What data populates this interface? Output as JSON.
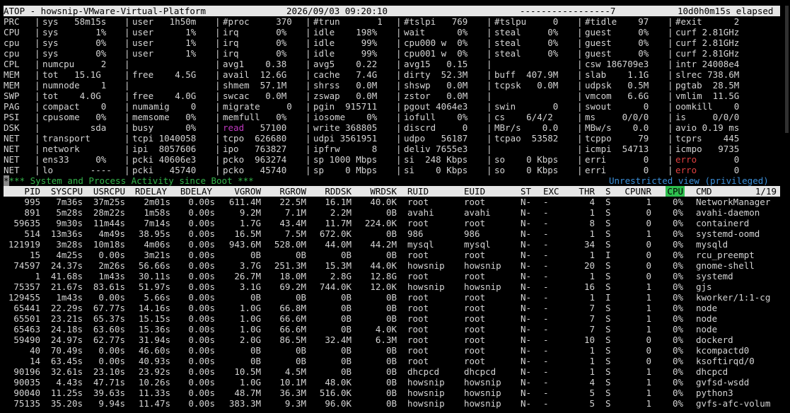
{
  "title": {
    "left": "ATOP - howsnip-VMware-Virtual-Platform",
    "datetime": "2026/09/03 09:20:10",
    "dashes": "-----------------7",
    "elapsed": "10d0h0m15s elapsed"
  },
  "sysstat": [
    {
      "label": "PRC",
      "c": [
        "sys   58m15s",
        "user   1h50m",
        "#proc     370",
        "#trun       1",
        "#tslpi   769",
        "#tslpu     0",
        "#tidle    97",
        "#exit      2"
      ]
    },
    {
      "label": "CPU",
      "c": [
        "sys       1%",
        "user      1%",
        "irq       0%",
        "idle    198%",
        "wait      0%",
        "steal     0%",
        "guest     0%",
        "curf 2.81GHz"
      ]
    },
    {
      "label": "cpu",
      "c": [
        "sys       0%",
        "user      1%",
        "irq       0%",
        "idle     99%",
        "cpu000 w  0%",
        "steal     0%",
        "guest     0%",
        "curf 2.81GHz"
      ]
    },
    {
      "label": "cpu",
      "c": [
        "sys       0%",
        "user      1%",
        "irq       0%",
        "idle     99%",
        "cpu001 w  0%",
        "steal     0%",
        "guest     0%",
        "curf 2.81GHz"
      ]
    },
    {
      "label": "CPL",
      "c": [
        "numcpu     2",
        "",
        "avg1    0.38",
        "avg5    0.22",
        "avg15   0.15",
        "",
        "csw 186709e3",
        "intr 24008e4"
      ]
    },
    {
      "label": "MEM",
      "c": [
        "tot   15.1G",
        "free    4.5G",
        "avail  12.6G",
        "cache   7.4G",
        "dirty  52.3M",
        "buff  407.9M",
        "slab    1.1G",
        "slrec 738.6M"
      ]
    },
    {
      "label": "MEM",
      "c": [
        "numnode    1",
        "",
        "shmem  57.1M",
        "shrss   0.0M",
        "shswp   0.0M",
        "tcpsk   0.0M",
        "udpsk   0.5M",
        "pgtab  28.5M"
      ]
    },
    {
      "label": "SWP",
      "c": [
        "tot    4.0G",
        "free    4.0G",
        "swcac   0.0M",
        "zswap   0.0M",
        "zstor   0.0M",
        "",
        "vmcom   6.6G",
        "vmlim  11.5G"
      ]
    },
    {
      "label": "PAG",
      "c": [
        "compact    0",
        "numamig    0",
        "migrate     0",
        "pgin  915711",
        "pgout 4064e3",
        "swin       0",
        "swout      0",
        "oomkill    0"
      ]
    },
    {
      "label": "PSI",
      "c": [
        "cpusome   0%",
        "memsome   0%",
        "memfull   0%",
        "iosome    0%",
        "iofull    0%",
        "cs    6/4/2",
        "ms     0/0/0",
        "is     0/0/0"
      ]
    },
    {
      "label": "DSK",
      "c": [
        "         sda",
        "busy      0%",
        "read   57100",
        "write 368805",
        "discrd     0",
        "MBr/s    0.0",
        "MBw/s    0.0",
        "avio 0.19 ms"
      ]
    },
    {
      "label": "NET",
      "c": [
        "transport",
        "tcpi 1040058",
        "tcpo  626680",
        "udpi 3561951",
        "udpo   56187",
        "tcpao  53582",
        "tcppo     79",
        "tcprs    445"
      ]
    },
    {
      "label": "NET",
      "c": [
        "network",
        "ipi  8057606",
        "ipo   763827",
        "ipfrw      8",
        "deliv 7655e3",
        "",
        "icmpi  54713",
        "icmpo   9735"
      ]
    },
    {
      "label": "NET",
      "c": [
        "ens33     0%",
        "pcki 40606e3",
        "pcko  963274",
        "sp 1000 Mbps",
        "si  248 Kbps",
        "so    0 Kbps",
        "erri       0",
        "erro       0"
      ]
    },
    {
      "label": "NET",
      "c": [
        "lo       ----",
        "pcki   45740",
        "pcko   45740",
        "sp    0 Mbps",
        "si    0 Kbps",
        "so    0 Kbps",
        "erri       0",
        "erro       0"
      ]
    }
  ],
  "status": {
    "left": "*** System and Process Activity since Boot ***",
    "right": "Unrestricted view (privileged)"
  },
  "columns": [
    "PID",
    "SYSCPU",
    "USRCPU",
    "RDELAY",
    "BDELAY",
    "VGROW",
    "RGROW",
    "RDDSK",
    "WRDSK",
    "RUID",
    "EUID",
    "ST",
    "EXC",
    "THR",
    "S",
    "CPUNR",
    "CPU",
    "CMD",
    "1/19"
  ],
  "processes": [
    [
      "995",
      "7m36s",
      "37m25s",
      "2m01s",
      "0.00s",
      "611.4M",
      "22.5M",
      "16.1M",
      "40.0K",
      "root",
      "root",
      "N-",
      "-",
      "4",
      "S",
      "1",
      "0%",
      "NetworkManager"
    ],
    [
      "891",
      "5m28s",
      "28m22s",
      "1m58s",
      "0.00s",
      "9.2M",
      "7.1M",
      "2.2M",
      "0B",
      "avahi",
      "avahi",
      "N-",
      "-",
      "1",
      "S",
      "0",
      "0%",
      "avahi-daemon"
    ],
    [
      "59635",
      "9m30s",
      "11m44s",
      "7m14s",
      "0.00s",
      "1.7G",
      "43.4M",
      "11.7M",
      "224.0K",
      "root",
      "root",
      "N-",
      "-",
      "8",
      "S",
      "0",
      "0%",
      "containerd"
    ],
    [
      "514",
      "13m36s",
      "4m49s",
      "38.95s",
      "0.00s",
      "16.5M",
      "7.5M",
      "672.0K",
      "0B",
      "986",
      "986",
      "N-",
      "-",
      "1",
      "S",
      "1",
      "0%",
      "systemd-oomd"
    ],
    [
      "121919",
      "3m28s",
      "10m18s",
      "4m06s",
      "0.00s",
      "943.6M",
      "528.0M",
      "44.0M",
      "44.2M",
      "mysql",
      "mysql",
      "N-",
      "-",
      "34",
      "S",
      "0",
      "0%",
      "mysqld"
    ],
    [
      "15",
      "4m25s",
      "0.00s",
      "3m21s",
      "0.00s",
      "0B",
      "0B",
      "0B",
      "0B",
      "root",
      "root",
      "N-",
      "-",
      "1",
      "I",
      "0",
      "0%",
      "rcu_preempt"
    ],
    [
      "74597",
      "24.37s",
      "2m26s",
      "56.66s",
      "0.00s",
      "3.7G",
      "251.3M",
      "15.3M",
      "44.0K",
      "howsnip",
      "howsnip",
      "N-",
      "-",
      "20",
      "S",
      "0",
      "0%",
      "gnome-shell"
    ],
    [
      "1",
      "41.68s",
      "1m43s",
      "30.11s",
      "0.00s",
      "26.7M",
      "18.0M",
      "2.8G",
      "12.8G",
      "root",
      "root",
      "N-",
      "-",
      "1",
      "S",
      "0",
      "0%",
      "systemd"
    ],
    [
      "75357",
      "21.67s",
      "83.61s",
      "51.97s",
      "0.00s",
      "3.1G",
      "69.2M",
      "744.0K",
      "12.0K",
      "howsnip",
      "howsnip",
      "N-",
      "-",
      "16",
      "S",
      "1",
      "0%",
      "gjs"
    ],
    [
      "129455",
      "1m43s",
      "0.00s",
      "5.66s",
      "0.00s",
      "0B",
      "0B",
      "0B",
      "0B",
      "root",
      "root",
      "N-",
      "-",
      "1",
      "I",
      "1",
      "0%",
      "kworker/1:1-cg"
    ],
    [
      "65441",
      "22.29s",
      "67.77s",
      "14.16s",
      "0.00s",
      "1.0G",
      "66.8M",
      "0B",
      "0B",
      "root",
      "root",
      "N-",
      "-",
      "7",
      "S",
      "1",
      "0%",
      "node"
    ],
    [
      "65501",
      "23.21s",
      "65.37s",
      "15.15s",
      "0.00s",
      "1.0G",
      "66.6M",
      "0B",
      "0B",
      "root",
      "root",
      "N-",
      "-",
      "7",
      "S",
      "1",
      "0%",
      "node"
    ],
    [
      "65463",
      "24.18s",
      "63.60s",
      "15.36s",
      "0.00s",
      "1.0G",
      "66.6M",
      "0B",
      "4.0K",
      "root",
      "root",
      "N-",
      "-",
      "7",
      "S",
      "1",
      "0%",
      "node"
    ],
    [
      "59490",
      "24.97s",
      "62.77s",
      "31.94s",
      "0.00s",
      "2.0G",
      "86.5M",
      "32.4M",
      "6.3M",
      "root",
      "root",
      "N-",
      "-",
      "10",
      "S",
      "0",
      "0%",
      "dockerd"
    ],
    [
      "40",
      "70.49s",
      "0.00s",
      "46.60s",
      "0.00s",
      "0B",
      "0B",
      "0B",
      "0B",
      "root",
      "root",
      "N-",
      "-",
      "1",
      "S",
      "0",
      "0%",
      "kcompactd0"
    ],
    [
      "14",
      "63.45s",
      "0.00s",
      "40.93s",
      "0.00s",
      "0B",
      "0B",
      "0B",
      "0B",
      "root",
      "root",
      "N-",
      "-",
      "1",
      "S",
      "0",
      "0%",
      "ksoftirqd/0"
    ],
    [
      "90196",
      "32.61s",
      "23.10s",
      "23.92s",
      "0.00s",
      "10.5M",
      "4.5M",
      "0B",
      "0B",
      "dhcpcd",
      "dhcpcd",
      "N-",
      "-",
      "1",
      "S",
      "1",
      "0%",
      "dhcpcd"
    ],
    [
      "90035",
      "4.43s",
      "47.71s",
      "10.26s",
      "0.00s",
      "1.0G",
      "10.1M",
      "48.0K",
      "0B",
      "howsnip",
      "howsnip",
      "N-",
      "-",
      "4",
      "S",
      "1",
      "0%",
      "gvfsd-wsdd"
    ],
    [
      "90040",
      "11.25s",
      "39.63s",
      "11.33s",
      "0.00s",
      "48.7M",
      "36.3M",
      "516.0K",
      "0B",
      "howsnip",
      "howsnip",
      "N-",
      "-",
      "5",
      "S",
      "1",
      "0%",
      "python3"
    ],
    [
      "75135",
      "35.20s",
      "9.94s",
      "11.47s",
      "0.00s",
      "383.3M",
      "9.3M",
      "96.0K",
      "0B",
      "howsnip",
      "howsnip",
      "N-",
      "-",
      "5",
      "S",
      "1",
      "0%",
      "gvfs-afc-volum"
    ]
  ]
}
